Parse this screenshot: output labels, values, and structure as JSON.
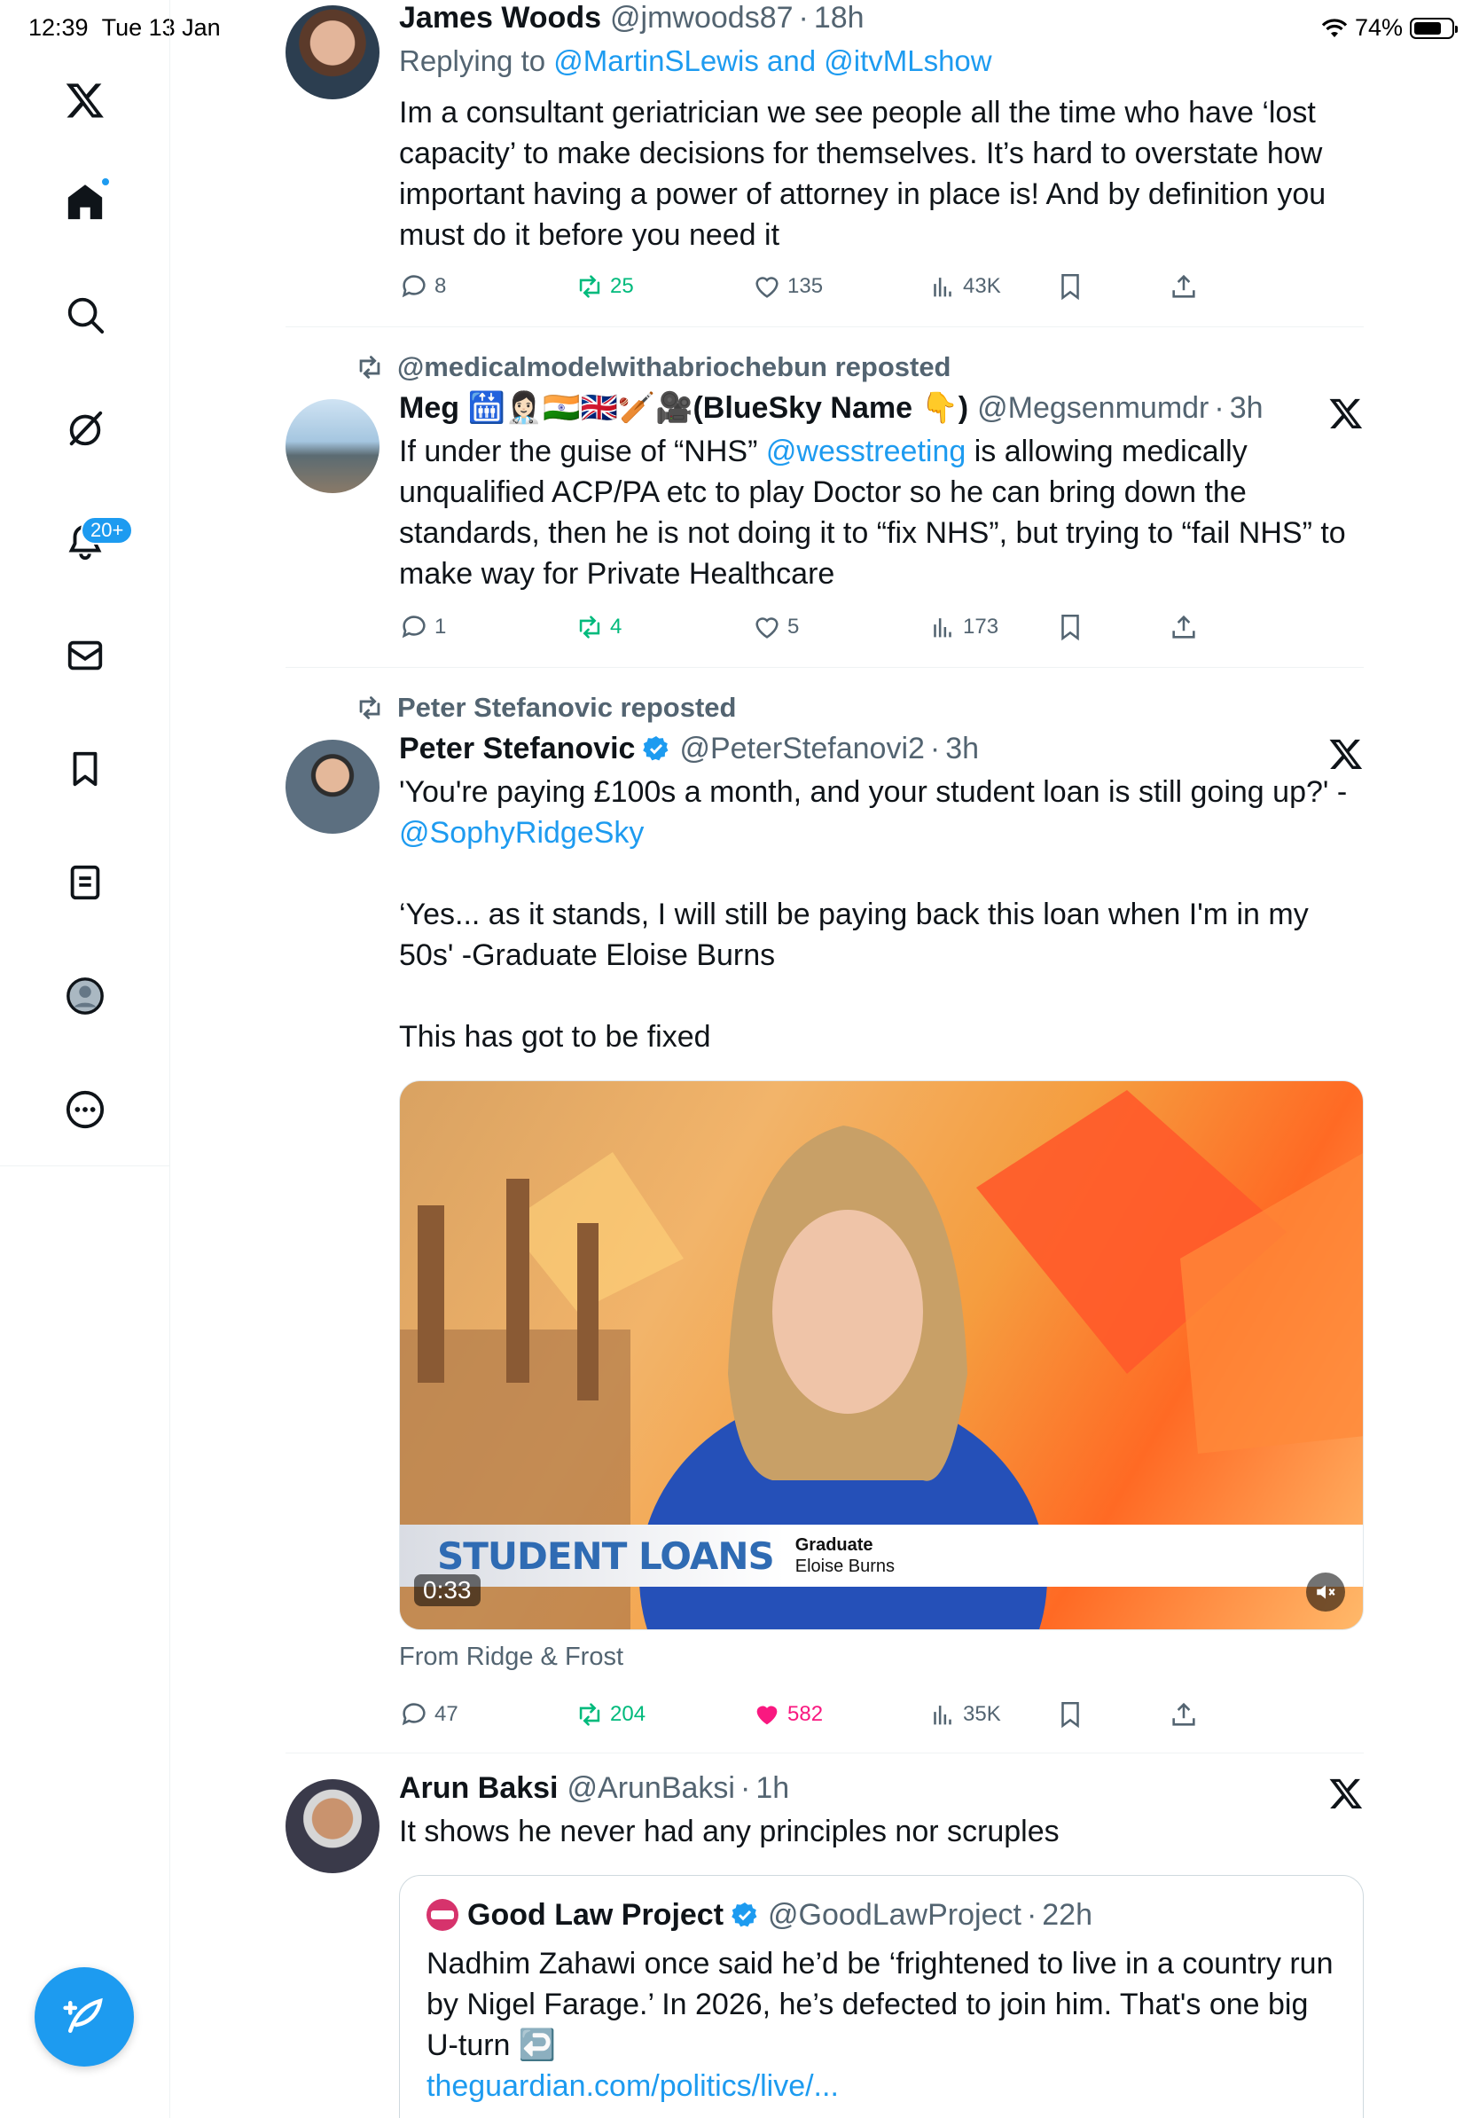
{
  "status_bar": {
    "time": "12:39",
    "date": "Tue 13 Jan",
    "battery": "74%"
  },
  "sidebar": {
    "notifications_badge": "20+",
    "items": [
      "x-logo",
      "home",
      "search",
      "grok",
      "notifications",
      "messages",
      "bookmarks",
      "lists",
      "profile",
      "more"
    ]
  },
  "tweets": [
    {
      "name": "James Woods",
      "handle": "@jmwoods87",
      "time": "18h",
      "reply_to_label": "Replying to",
      "reply_to": "@MartinSLewis and @itvMLshow",
      "text": "Im a consultant geriatrician we see people all the time who have ‘lost capacity’ to make decisions for themselves. It’s hard to overstate how important having a power of attorney in place is! And by definition you must do it before you need it",
      "replies": "8",
      "reposts": "25",
      "likes": "135",
      "views": "43K"
    },
    {
      "repost_line": "@medicalmodelwithabriochebun reposted",
      "name": "Meg 🛗👩🏻‍⚕️🇮🇳🇬🇧🏏🎥(BlueSky Name 👇)",
      "handle": "@Megsenmumdr",
      "time": "3h",
      "text_pre": "If under the guise of “NHS” ",
      "text_link": "@wesstreeting",
      "text_post": " is allowing medically unqualified ACP/PA etc to play Doctor so he can bring down the standards, then he is not doing it to “fix NHS”, but trying to “fail NHS” to make way for Private Healthcare",
      "replies": "1",
      "reposts": "4",
      "likes": "5",
      "views": "173"
    },
    {
      "repost_line": "Peter Stefanovic reposted",
      "name": "Peter Stefanovic",
      "handle": "@PeterStefanovi2",
      "time": "3h",
      "text_line1": "'You're paying £100s a month, and your student loan is still going up?' -",
      "text_link": "@SophyRidgeSky",
      "text_para2": "‘Yes... as it stands, I will still be paying back this loan when I'm in my 50s' -Graduate Eloise Burns",
      "text_para3": "This has got to be fixed",
      "media": {
        "lower_third_title": "STUDENT LOANS",
        "lower_third_role": "Graduate",
        "lower_third_name": "Eloise Burns",
        "duration": "0:33"
      },
      "source": "From Ridge & Frost",
      "replies": "47",
      "reposts": "204",
      "likes": "582",
      "views": "35K"
    },
    {
      "name": "Arun Baksi",
      "handle": "@ArunBaksi",
      "time": "1h",
      "text": "It shows he never had any principles nor scruples",
      "quote": {
        "name": "Good Law Project",
        "handle": "@GoodLawProject",
        "time": "22h",
        "text": "Nadhim Zahawi once said he’d be ‘frightened to live in a country run by Nigel Farage.’ In 2026, he’s defected to join him. That's one big U-turn ↩️",
        "link": "theguardian.com/politics/live/..."
      }
    }
  ],
  "colors": {
    "accent": "#1d9bf0",
    "repost_green": "#00ba7c",
    "like_pink": "#f91880",
    "secondary_text": "#536471"
  }
}
